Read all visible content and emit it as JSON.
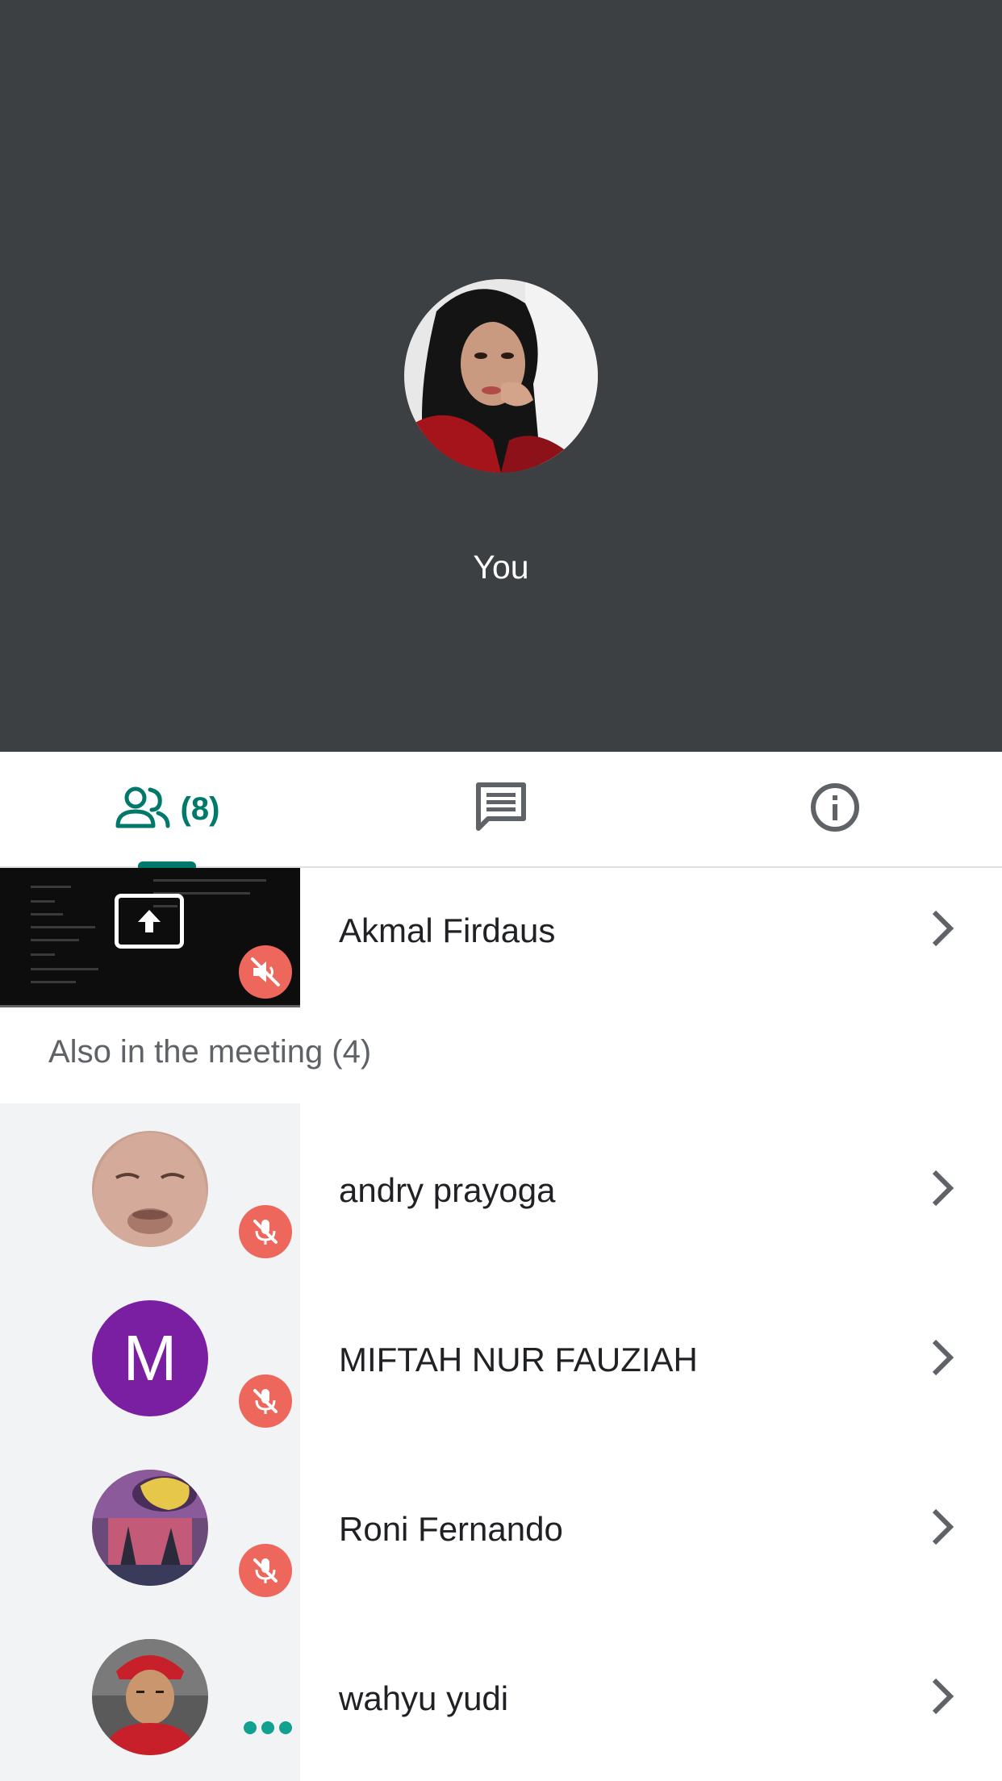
{
  "self_view": {
    "name": "You"
  },
  "tabs": {
    "people": {
      "icon": "people-icon",
      "count": "(8)"
    },
    "chat": {
      "icon": "chat-icon"
    },
    "info": {
      "icon": "info-icon"
    },
    "active_color": "#00796b"
  },
  "presenter": {
    "name": "Akmal Firdaus",
    "icon": "present-screen-icon",
    "status_icon": "volume-off-icon"
  },
  "section": {
    "title": "Also in the meeting (4)"
  },
  "participants": [
    {
      "name": "andry prayoga",
      "status": "muted"
    },
    {
      "name": "MIFTAH NUR FAUZIAH",
      "initial": "M",
      "status": "muted"
    },
    {
      "name": "Roni Fernando",
      "status": "muted"
    },
    {
      "name": "wahyu yudi",
      "status": "speaking"
    }
  ],
  "colors": {
    "self_background": "#3c4043",
    "mute_badge": "#ee675c",
    "avatar_letter_bg": "#7b1fa2",
    "speaking_dots": "#12a08f"
  }
}
